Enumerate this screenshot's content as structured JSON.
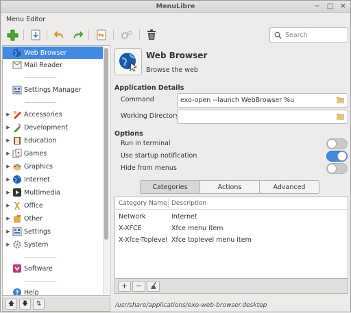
{
  "window": {
    "title": "MenuLibre"
  },
  "subtitle": "Menu Editor",
  "search": {
    "placeholder": "Search"
  },
  "sidebar": {
    "items": [
      {
        "label": "Web Browser",
        "icon": "globe-icon",
        "selected": true
      },
      {
        "label": "Mail Reader",
        "icon": "mail-icon"
      },
      {
        "label": "Settings Manager",
        "icon": "settings-manager-icon"
      },
      {
        "label": "Accessories",
        "icon": "accessories-icon"
      },
      {
        "label": "Development",
        "icon": "development-icon"
      },
      {
        "label": "Education",
        "icon": "education-icon"
      },
      {
        "label": "Games",
        "icon": "games-icon"
      },
      {
        "label": "Graphics",
        "icon": "graphics-icon"
      },
      {
        "label": "Internet",
        "icon": "internet-icon"
      },
      {
        "label": "Multimedia",
        "icon": "multimedia-icon"
      },
      {
        "label": "Office",
        "icon": "office-icon"
      },
      {
        "label": "Other",
        "icon": "other-icon"
      },
      {
        "label": "Settings",
        "icon": "settings-icon"
      },
      {
        "label": "System",
        "icon": "system-icon"
      },
      {
        "label": "Software",
        "icon": "software-icon"
      },
      {
        "label": "Help",
        "icon": "help-icon"
      }
    ]
  },
  "app": {
    "name": "Web Browser",
    "comment": "Browse the web"
  },
  "details": {
    "section_title": "Application Details",
    "command_label": "Command",
    "command_value": "exo-open --launch WebBrowser %u",
    "workdir_label": "Working Directory",
    "workdir_value": ""
  },
  "options": {
    "section_title": "Options",
    "run_in_terminal": {
      "label": "Run in terminal",
      "on": false
    },
    "startup_notification": {
      "label": "Use startup notification",
      "on": true
    },
    "hide_from_menus": {
      "label": "Hide from menus",
      "on": false
    }
  },
  "tabs": [
    {
      "label": "Categories",
      "active": true
    },
    {
      "label": "Actions",
      "active": false
    },
    {
      "label": "Advanced",
      "active": false
    }
  ],
  "categories": {
    "headers": [
      "Category Name",
      "Description"
    ],
    "rows": [
      [
        "Network",
        "Internet"
      ],
      [
        "X-XFCE",
        "Xfce menu item"
      ],
      [
        "X-Xfce-Toplevel",
        "Xfce toplevel menu item"
      ]
    ]
  },
  "filepath": "/usr/share/applications/exo-web-browser.desktop",
  "colors": {
    "accent": "#3f8ae2"
  }
}
